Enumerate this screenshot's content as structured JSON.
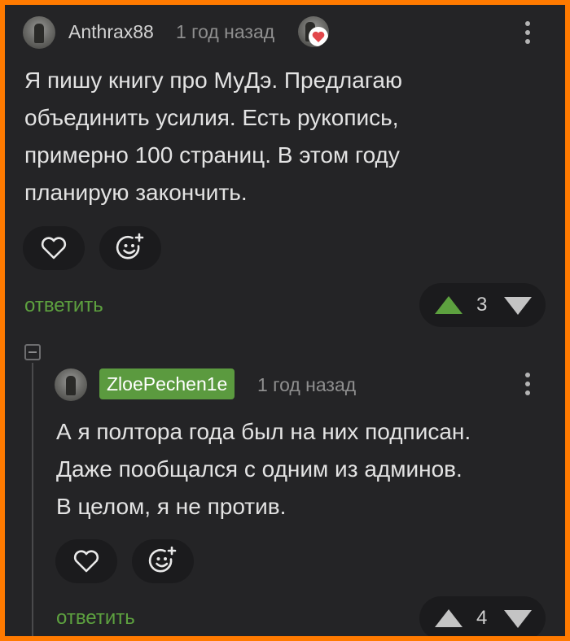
{
  "comment": {
    "username": "Anthrax88",
    "time": "1 год назад",
    "lines": [
      "Я пишу книгу про МуДэ. Предлагаю",
      "объединить усилия. Есть рукопись,",
      "примерно 100 страниц. В этом году",
      "планирую закончить."
    ],
    "reply_label": "ответить",
    "rating": "3",
    "upvoted": true
  },
  "reply": {
    "username": "ZloePechen1e",
    "time": "1 год назад",
    "lines": [
      "А я полтора года был на них подписан.",
      "Даже пообщался с одним из админов.",
      "В целом, я не против."
    ],
    "reply_label": "ответить",
    "rating": "4",
    "upvoted": false
  },
  "icons": {
    "more": "more-vertical-icon",
    "like": "heart-icon",
    "react": "emoji-add-icon",
    "collapse": "minus-square-icon",
    "upvote": "triangle-up-icon",
    "downvote": "triangle-down-icon",
    "badge": "heart-badge-icon"
  },
  "colors": {
    "frame": "#ff7a00",
    "background": "#242426",
    "accent_green": "#5da13f",
    "badge_bg": "#5b9a3f",
    "heart_badge": "#e2474b"
  }
}
